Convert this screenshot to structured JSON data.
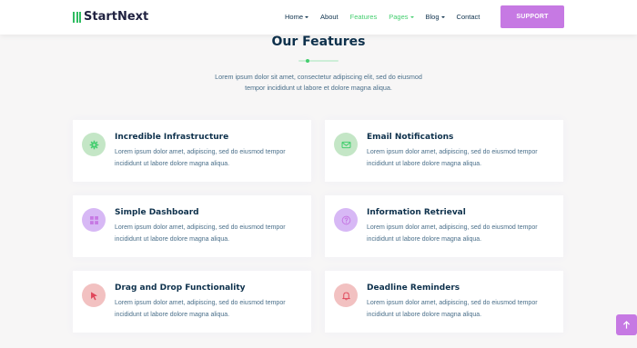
{
  "header": {
    "logo_text": "StartNext",
    "nav": [
      {
        "label": "Home",
        "dropdown": true
      },
      {
        "label": "About",
        "dropdown": false
      },
      {
        "label": "Features",
        "dropdown": false,
        "active": true
      },
      {
        "label": "Pages",
        "dropdown": true,
        "active": true
      },
      {
        "label": "Blog",
        "dropdown": true
      },
      {
        "label": "Contact",
        "dropdown": false
      }
    ],
    "support_label": "SUPPORT"
  },
  "section": {
    "title": "Our Features",
    "description_line1": "Lorem ipsum dolor sit amet, consectetur adipiscing elit, sed do eiusmod",
    "description_line2": "tempor incididunt ut labore et dolore magna aliqua."
  },
  "features": [
    {
      "title": "Incredible Infrastructure",
      "text_line1": "Lorem ipsum dolor amet, adipiscing, sed do eiusmod tempor",
      "text_line2": "incididunt ut labore dolore magna aliqua.",
      "icon": "gear-icon",
      "icon_color": "#44ce6f"
    },
    {
      "title": "Email Notifications",
      "text_line1": "Lorem ipsum dolor amet, adipiscing, sed do eiusmod tempor",
      "text_line2": "incididunt ut labore dolore magna aliqua.",
      "icon": "mail-icon",
      "icon_color": "#44ce6f"
    },
    {
      "title": "Simple Dashboard",
      "text_line1": "Lorem ipsum dolor amet, adipiscing, sed do eiusmod tempor",
      "text_line2": "incididunt ut labore dolore magna aliqua.",
      "icon": "grid-icon",
      "icon_color": "#c679e3"
    },
    {
      "title": "Information Retrieval",
      "text_line1": "Lorem ipsum dolor amet, adipiscing, sed do eiusmod tempor",
      "text_line2": "incididunt ut labore dolore magna aliqua.",
      "icon": "help-circle-icon",
      "icon_color": "#c679e3"
    },
    {
      "title": "Drag and Drop Functionality",
      "text_line1": "Lorem ipsum dolor amet, adipiscing, sed do eiusmod tempor",
      "text_line2": "incididunt ut labore dolore magna aliqua.",
      "icon": "cursor-icon",
      "icon_color": "#eb6b3d"
    },
    {
      "title": "Deadline Reminders",
      "text_line1": "Lorem ipsum dolor amet, adipiscing, sed do eiusmod tempor",
      "text_line2": "incididunt ut labore dolore magna aliqua.",
      "icon": "bell-icon",
      "icon_color": "#eb6b3d"
    }
  ],
  "colors": {
    "accent_green": "#44ce6f",
    "accent_purple": "#c679e3",
    "heading": "#0e314c",
    "body_text": "#4a6f8a"
  },
  "back_to_top_icon": "arrow-up-icon"
}
